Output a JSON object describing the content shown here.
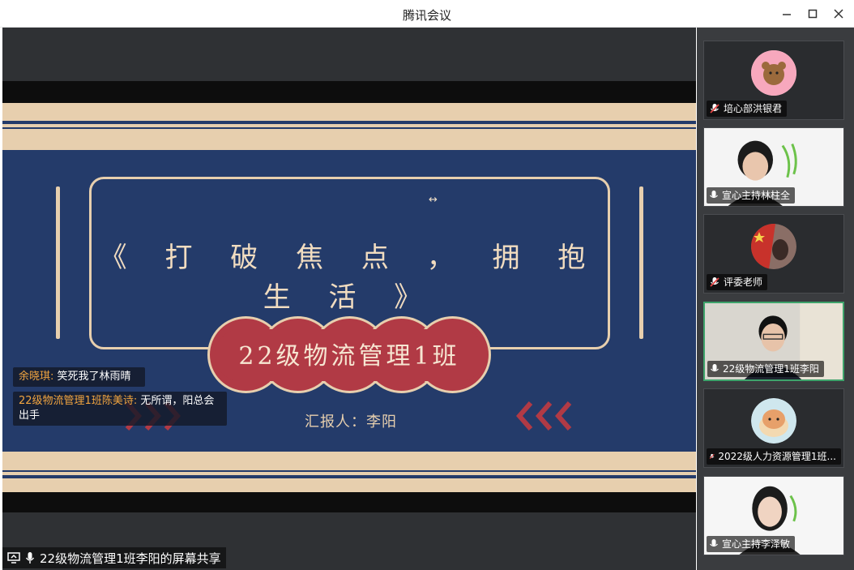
{
  "window": {
    "title": "腾讯会议"
  },
  "slide": {
    "title": "《 打 破 焦 点 ， 拥 抱 生 活 》",
    "class_name": "22级物流管理1班",
    "reporter": "汇报人：李阳",
    "colors": {
      "navy": "#243b6a",
      "beige": "#e7cfae",
      "crimson": "#b13a45"
    }
  },
  "chat": [
    {
      "name": "余晓琪:",
      "message": " 笑死我了林雨晴"
    },
    {
      "name": "22级物流管理1班陈美诗:",
      "message": " 无所谓，阳总会出手"
    }
  ],
  "share_banner": {
    "text": "22级物流管理1班李阳的屏幕共享"
  },
  "participants": [
    {
      "name": "培心部洪银君",
      "mic": "muted",
      "type": "avatar"
    },
    {
      "name": "宣心主持林柱全",
      "mic": "on",
      "type": "video"
    },
    {
      "name": "评委老师",
      "mic": "muted",
      "type": "avatar"
    },
    {
      "name": "22级物流管理1班李阳",
      "mic": "on",
      "type": "video",
      "active": true
    },
    {
      "name": "2022级人力资源管理1班...",
      "mic": "muted",
      "type": "avatar"
    },
    {
      "name": "宣心主持李泽敏",
      "mic": "on",
      "type": "video"
    }
  ]
}
